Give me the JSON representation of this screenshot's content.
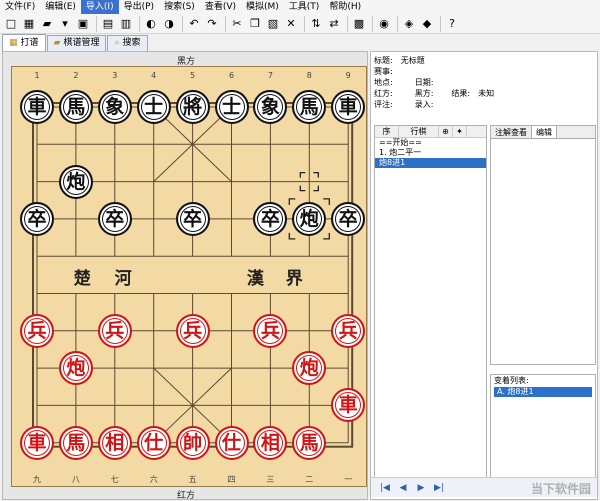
{
  "menu": [
    "文件(F)",
    "编辑(E)",
    "导入(I)",
    "导出(P)",
    "搜索(S)",
    "查看(V)",
    "模拟(M)",
    "工具(T)",
    "帮助(H)"
  ],
  "menu_active_index": 2,
  "toolbar_icons": [
    {
      "name": "new-icon",
      "glyph": "□"
    },
    {
      "name": "save-green-icon",
      "glyph": "▦"
    },
    {
      "name": "open-folder-icon",
      "glyph": "▰"
    },
    {
      "name": "dropdown-arrow-icon",
      "glyph": "▾"
    },
    {
      "name": "save-disk-icon",
      "glyph": "▣"
    },
    {
      "name": "sep",
      "glyph": ""
    },
    {
      "name": "copy-board-icon",
      "glyph": "▤"
    },
    {
      "name": "delete-icon",
      "glyph": "▥"
    },
    {
      "name": "sep",
      "glyph": ""
    },
    {
      "name": "back-circle-icon",
      "glyph": "◐"
    },
    {
      "name": "forward-circle-icon",
      "glyph": "◑"
    },
    {
      "name": "sep",
      "glyph": ""
    },
    {
      "name": "undo-icon",
      "glyph": "↶"
    },
    {
      "name": "redo-icon",
      "glyph": "↷"
    },
    {
      "name": "sep",
      "glyph": ""
    },
    {
      "name": "cut-icon",
      "glyph": "✂"
    },
    {
      "name": "copy-icon",
      "glyph": "❐"
    },
    {
      "name": "paste-icon",
      "glyph": "▧"
    },
    {
      "name": "close-x-icon",
      "glyph": "✕"
    },
    {
      "name": "sep",
      "glyph": ""
    },
    {
      "name": "flip-vertical-icon",
      "glyph": "⇅"
    },
    {
      "name": "flip-horizontal-icon",
      "glyph": "⇄"
    },
    {
      "name": "sep",
      "glyph": ""
    },
    {
      "name": "board-setup-icon",
      "glyph": "▩"
    },
    {
      "name": "sep",
      "glyph": ""
    },
    {
      "name": "engine-icon",
      "glyph": "◉"
    },
    {
      "name": "sep",
      "glyph": ""
    },
    {
      "name": "tag-icon",
      "glyph": "◈"
    },
    {
      "name": "tags-icon",
      "glyph": "◆"
    },
    {
      "name": "sep",
      "glyph": ""
    },
    {
      "name": "help-icon",
      "glyph": "?"
    }
  ],
  "tabs": [
    {
      "label": "打谱",
      "icon": "board-icon",
      "glyph": "▦"
    },
    {
      "label": "棋谱管理",
      "icon": "folder-icon",
      "glyph": "▰"
    },
    {
      "label": "搜索",
      "icon": "search-icon",
      "glyph": "⌕"
    }
  ],
  "board": {
    "top_side": "黑方",
    "bottom_side": "红方",
    "top_files": [
      "1",
      "2",
      "3",
      "4",
      "5",
      "6",
      "7",
      "8",
      "9"
    ],
    "bottom_files": [
      "九",
      "八",
      "七",
      "六",
      "五",
      "四",
      "三",
      "二",
      "一"
    ],
    "river_left": [
      "楚",
      "河"
    ],
    "river_right": [
      "漢",
      "界"
    ],
    "pieces": [
      {
        "c": "車",
        "side": "black",
        "file": 0,
        "rank": 0
      },
      {
        "c": "馬",
        "side": "black",
        "file": 1,
        "rank": 0
      },
      {
        "c": "象",
        "side": "black",
        "file": 2,
        "rank": 0
      },
      {
        "c": "士",
        "side": "black",
        "file": 3,
        "rank": 0
      },
      {
        "c": "將",
        "side": "black",
        "file": 4,
        "rank": 0
      },
      {
        "c": "士",
        "side": "black",
        "file": 5,
        "rank": 0
      },
      {
        "c": "象",
        "side": "black",
        "file": 6,
        "rank": 0
      },
      {
        "c": "馬",
        "side": "black",
        "file": 7,
        "rank": 0
      },
      {
        "c": "車",
        "side": "black",
        "file": 8,
        "rank": 0
      },
      {
        "c": "炮",
        "side": "black",
        "file": 1,
        "rank": 2
      },
      {
        "c": "炮",
        "side": "black",
        "file": 7,
        "rank": 3
      },
      {
        "c": "卒",
        "side": "black",
        "file": 0,
        "rank": 3
      },
      {
        "c": "卒",
        "side": "black",
        "file": 2,
        "rank": 3
      },
      {
        "c": "卒",
        "side": "black",
        "file": 4,
        "rank": 3
      },
      {
        "c": "卒",
        "side": "black",
        "file": 6,
        "rank": 3
      },
      {
        "c": "卒",
        "side": "black",
        "file": 8,
        "rank": 3
      },
      {
        "c": "兵",
        "side": "red",
        "file": 0,
        "rank": 6
      },
      {
        "c": "兵",
        "side": "red",
        "file": 2,
        "rank": 6
      },
      {
        "c": "兵",
        "side": "red",
        "file": 4,
        "rank": 6
      },
      {
        "c": "兵",
        "side": "red",
        "file": 6,
        "rank": 6
      },
      {
        "c": "兵",
        "side": "red",
        "file": 8,
        "rank": 6
      },
      {
        "c": "炮",
        "side": "red",
        "file": 1,
        "rank": 7
      },
      {
        "c": "炮",
        "side": "red",
        "file": 7,
        "rank": 7
      },
      {
        "c": "車",
        "side": "red",
        "file": 8,
        "rank": 8
      },
      {
        "c": "車",
        "side": "red",
        "file": 0,
        "rank": 9
      },
      {
        "c": "馬",
        "side": "red",
        "file": 1,
        "rank": 9
      },
      {
        "c": "相",
        "side": "red",
        "file": 2,
        "rank": 9
      },
      {
        "c": "仕",
        "side": "red",
        "file": 3,
        "rank": 9
      },
      {
        "c": "帥",
        "side": "red",
        "file": 4,
        "rank": 9
      },
      {
        "c": "仕",
        "side": "red",
        "file": 5,
        "rank": 9
      },
      {
        "c": "相",
        "side": "red",
        "file": 6,
        "rank": 9
      },
      {
        "c": "馬",
        "side": "red",
        "file": 7,
        "rank": 9
      }
    ],
    "from_marker": {
      "file": 7,
      "rank": 2
    },
    "to_marker": {
      "file": 7,
      "rank": 3
    }
  },
  "info": {
    "title_label": "标题:",
    "title_value": "无标题",
    "event_label": "赛事:",
    "place_label": "地点:",
    "date_label": "日期:",
    "red_label": "红方:",
    "black_label": "黑方:",
    "result_label": "结果:",
    "result_value": "未知",
    "comment_label": "评注:",
    "entry_label": "录入:"
  },
  "moves": {
    "headers": [
      "序",
      "行棋",
      "⊕",
      "✦"
    ],
    "rows": [
      {
        "text": "==开始==",
        "selected": false
      },
      {
        "text": "1.  炮二平一",
        "selected": false
      },
      {
        "text": "  炮8进1",
        "selected": true
      }
    ]
  },
  "notes_tabs": [
    "注解查看",
    "编辑"
  ],
  "notes_active": 1,
  "variations": {
    "title": "变着列表:",
    "items": [
      "A. 炮8进1"
    ]
  },
  "nav": {
    "first": "|◀",
    "prev": "◀",
    "next": "▶",
    "last": "▶|",
    "watermark": "当下软件园"
  }
}
